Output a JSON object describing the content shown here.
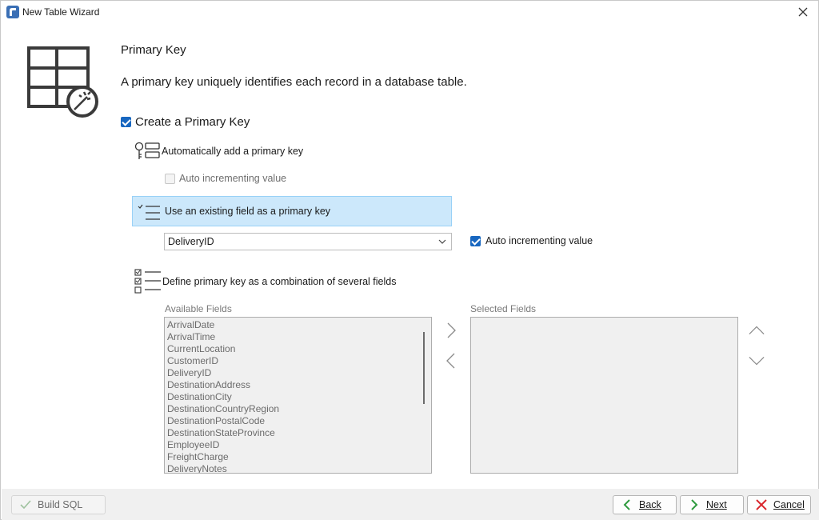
{
  "window": {
    "title": "New Table Wizard",
    "app_icon": "app-icon",
    "close_icon": "close-icon"
  },
  "page": {
    "heading": "Primary Key",
    "description": "A primary key uniquely identifies each record in a database table.",
    "icon": "table-wizard-icon"
  },
  "create_pk": {
    "label": "Create a Primary Key",
    "checked": true
  },
  "options": {
    "auto_add": {
      "label": "Automatically add a primary key",
      "icon": "key-table-icon"
    },
    "auto_add_increment": {
      "label": "Auto incrementing value",
      "checked": false,
      "disabled": true
    },
    "existing": {
      "label": "Use an existing field as a primary key",
      "icon": "check-list-icon",
      "selected": true
    },
    "existing_field": {
      "value": "DeliveryID"
    },
    "existing_increment": {
      "label": "Auto incrementing value",
      "checked": true
    },
    "combination": {
      "label": "Define primary key as a combination of several fields",
      "icon": "checkbox-list-icon"
    }
  },
  "fields": {
    "available_label": "Available Fields",
    "selected_label": "Selected Fields",
    "available": [
      "ArrivalDate",
      "ArrivalTime",
      "CurrentLocation",
      "CustomerID",
      "DeliveryID",
      "DestinationAddress",
      "DestinationCity",
      "DestinationCountryRegion",
      "DestinationPostalCode",
      "DestinationStateProvince",
      "EmployeeID",
      "FreightCharge",
      "DeliveryNotes"
    ],
    "selected": []
  },
  "footer": {
    "build_sql": "Build SQL",
    "back_label": "Back",
    "next_label": "Next",
    "cancel_label": "Cancel"
  },
  "colors": {
    "accent": "#1867c0",
    "selection": "#cce8fb",
    "footer_bg": "#f0f0f0"
  }
}
